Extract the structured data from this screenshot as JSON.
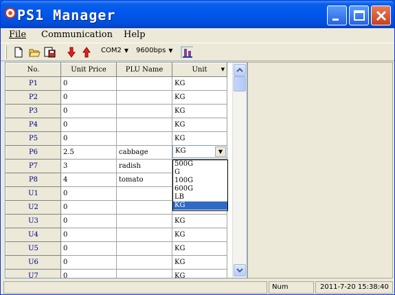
{
  "window": {
    "title": "PS1 Manager"
  },
  "menu": {
    "file": "File",
    "communication": "Communication",
    "help": "Help"
  },
  "toolbar": {
    "port": "COM2",
    "baud": "9600bps"
  },
  "grid": {
    "headers": [
      "No.",
      "Unit Price",
      "PLU Name",
      "Unit"
    ],
    "rows": [
      {
        "no": "P1",
        "price": "0",
        "name": "",
        "unit": "KG"
      },
      {
        "no": "P2",
        "price": "0",
        "name": "",
        "unit": "KG"
      },
      {
        "no": "P3",
        "price": "0",
        "name": "",
        "unit": "KG"
      },
      {
        "no": "P4",
        "price": "0",
        "name": "",
        "unit": "KG"
      },
      {
        "no": "P5",
        "price": "0",
        "name": "",
        "unit": "KG"
      },
      {
        "no": "P6",
        "price": "2.5",
        "name": "cabbage",
        "unit": ""
      },
      {
        "no": "P7",
        "price": "3",
        "name": "radish",
        "unit": ""
      },
      {
        "no": "P8",
        "price": "4",
        "name": "tomato",
        "unit": ""
      },
      {
        "no": "U1",
        "price": "0",
        "name": "",
        "unit": ""
      },
      {
        "no": "U2",
        "price": "0",
        "name": "",
        "unit": ""
      },
      {
        "no": "U3",
        "price": "0",
        "name": "",
        "unit": "KG"
      },
      {
        "no": "U4",
        "price": "0",
        "name": "",
        "unit": "KG"
      },
      {
        "no": "U5",
        "price": "0",
        "name": "",
        "unit": "KG"
      },
      {
        "no": "U6",
        "price": "0",
        "name": "",
        "unit": "KG"
      },
      {
        "no": "U7",
        "price": "0",
        "name": "",
        "unit": "KG"
      }
    ]
  },
  "unit_combo": {
    "value": "KG",
    "options": [
      "500G",
      "G",
      "100G",
      "600G",
      "LB",
      "KG"
    ],
    "selected": "KG"
  },
  "status": {
    "mode": "Num",
    "datetime": "2011-7-20 15:38:40"
  }
}
